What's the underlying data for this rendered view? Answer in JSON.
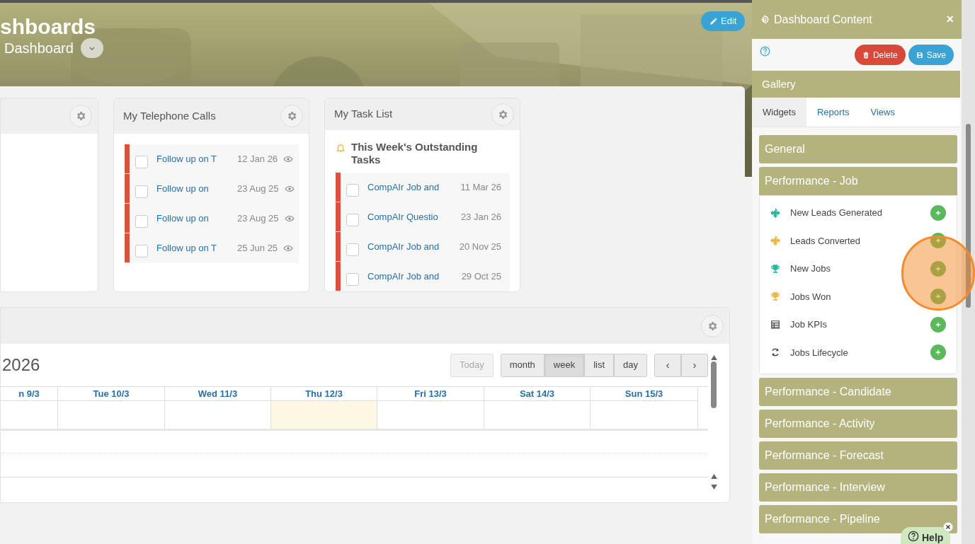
{
  "header": {
    "title": "shboards",
    "subtitle": "Dashboard",
    "edit_button": "Edit"
  },
  "calls_widget": {
    "title": "My Telephone Calls",
    "items": [
      {
        "text": "Follow up on T",
        "date": "12 Jan 26",
        "checked": false
      },
      {
        "text": "Follow up on",
        "date": "23 Aug 25",
        "checked": false
      },
      {
        "text": "Follow up on",
        "date": "23 Aug 25",
        "checked": false
      },
      {
        "text": "Follow up on T",
        "date": "25 Jun 25",
        "checked": false
      }
    ]
  },
  "tasks_widget": {
    "title": "My Task List",
    "heading": "This Week's Outstanding Tasks",
    "items": [
      {
        "text": "CompAIr Job and",
        "date": "11 Mar 26",
        "checked": false
      },
      {
        "text": "CompAIr Questio",
        "date": "23 Jan 26",
        "checked": false
      },
      {
        "text": "CompAIr Job and",
        "date": "20 Nov 25",
        "checked": false
      },
      {
        "text": "CompAIr Job and",
        "date": "29 Oct 25",
        "checked": false
      }
    ]
  },
  "calendar": {
    "title": "2026",
    "today_button": {
      "label": "Today",
      "disabled": true
    },
    "views": [
      {
        "label": "month",
        "selected": false
      },
      {
        "label": "week",
        "selected": true
      },
      {
        "label": "list",
        "selected": false
      },
      {
        "label": "day",
        "selected": false
      }
    ],
    "nav": [
      "‹",
      "›"
    ],
    "days": [
      {
        "label": "n 9/3",
        "today": false
      },
      {
        "label": "Tue 10/3",
        "today": false
      },
      {
        "label": "Wed 11/3",
        "today": false
      },
      {
        "label": "Thu 12/3",
        "today": true
      },
      {
        "label": "Fri 13/3",
        "today": false
      },
      {
        "label": "Sat 14/3",
        "today": false
      },
      {
        "label": "Sun 15/3",
        "today": false
      }
    ]
  },
  "panel": {
    "title": "Dashboard Content",
    "close": "×",
    "delete_button": "Delete",
    "save_button": "Save",
    "gallery": "Gallery",
    "tabs": [
      {
        "label": "Widgets",
        "selected": true
      },
      {
        "label": "Reports",
        "selected": false
      },
      {
        "label": "Views",
        "selected": false
      }
    ],
    "sections": [
      {
        "title": "General",
        "expanded": false
      },
      {
        "title": "Performance - Job",
        "expanded": true,
        "items": [
          {
            "label": "New Leads Generated",
            "kind": "move",
            "color": "#2bb5a0"
          },
          {
            "label": "Leads Converted",
            "kind": "move",
            "color": "#f0b443"
          },
          {
            "label": "New Jobs",
            "kind": "trophy",
            "color": "#2bb5a0"
          },
          {
            "label": "Jobs Won",
            "kind": "trophy",
            "color": "#f0b443"
          },
          {
            "label": "Job KPIs",
            "kind": "table",
            "color": "#444444"
          },
          {
            "label": "Jobs Lifecycle",
            "kind": "cycle",
            "color": "#444444"
          }
        ]
      },
      {
        "title": "Performance - Candidate",
        "expanded": false
      },
      {
        "title": "Performance - Activity",
        "expanded": false
      },
      {
        "title": "Performance - Forecast",
        "expanded": false
      },
      {
        "title": "Performance - Interview",
        "expanded": false
      },
      {
        "title": "Performance - Pipeline",
        "expanded": false
      }
    ]
  },
  "help_button": "Help"
}
